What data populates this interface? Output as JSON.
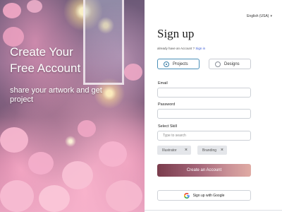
{
  "hero": {
    "title_line1": "Create Your",
    "title_line2": "Free Account",
    "subtitle": "share your artwork and get project"
  },
  "language": {
    "label": "English (USA)",
    "icon": "chevron-down-icon"
  },
  "form": {
    "heading": "Sign up",
    "have_account_text": "already have an Account ?",
    "signin_link": "Sign in",
    "account_types": [
      {
        "label": "Projects",
        "selected": true
      },
      {
        "label": "Designs",
        "selected": false
      }
    ],
    "email_label": "Email",
    "email_value": "",
    "password_label": "Password",
    "password_value": "",
    "skill_label": "Select Skill",
    "skill_placeholder": "Type to search",
    "selected_skills": [
      "Illustrator",
      "Branding"
    ],
    "remove_icon": "close-icon",
    "create_button": "Create an Account",
    "google_button": "Sign up with Google",
    "google_icon": "google-g-icon"
  },
  "colors": {
    "accent_link": "#3b5bd6",
    "toggle_active_border": "#4a8fb8",
    "button_gradient_start": "#7a3c4c",
    "button_gradient_end": "#e0aba4"
  }
}
